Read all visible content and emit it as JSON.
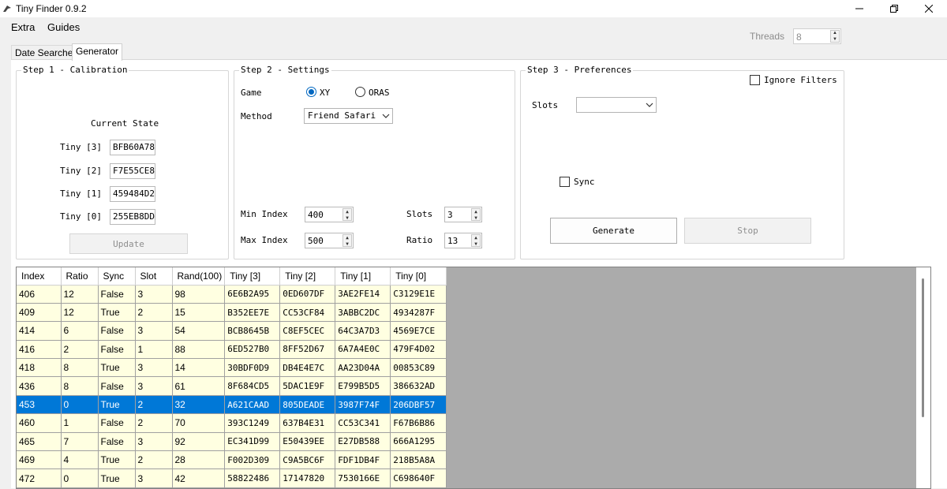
{
  "window": {
    "title": "Tiny Finder 0.9.2"
  },
  "menu": {
    "items": [
      {
        "label": "Extra"
      },
      {
        "label": "Guides"
      }
    ]
  },
  "threads": {
    "label": "Threads",
    "value": "8"
  },
  "tabs": [
    {
      "label": "Date Searcher"
    },
    {
      "label": "Generator"
    }
  ],
  "step1": {
    "title": "Step 1 - Calibration",
    "current_state_label": "Current State",
    "rows": [
      {
        "label": "Tiny [3]",
        "value": "BFB60A78"
      },
      {
        "label": "Tiny [2]",
        "value": "F7E55CE8"
      },
      {
        "label": "Tiny [1]",
        "value": "459484D2"
      },
      {
        "label": "Tiny [0]",
        "value": "255EB8DD"
      }
    ],
    "update_label": "Update"
  },
  "step2": {
    "title": "Step 2 - Settings",
    "game_label": "Game",
    "game_options": [
      {
        "label": "XY",
        "selected": true
      },
      {
        "label": "ORAS",
        "selected": false
      }
    ],
    "method_label": "Method",
    "method_value": "Friend Safari",
    "min_index_label": "Min Index",
    "min_index_value": "400",
    "max_index_label": "Max Index",
    "max_index_value": "500",
    "slots_label": "Slots",
    "slots_value": "3",
    "ratio_label": "Ratio",
    "ratio_value": "13"
  },
  "step3": {
    "title": "Step 3 - Preferences",
    "ignore_filters_label": "Ignore Filters",
    "slots_label": "Slots",
    "slots_value": "",
    "sync_label": "Sync",
    "generate_label": "Generate",
    "stop_label": "Stop"
  },
  "results": {
    "columns": [
      "Index",
      "Ratio",
      "Sync",
      "Slot",
      "Rand(100)",
      "Tiny [3]",
      "Tiny [2]",
      "Tiny [1]",
      "Tiny [0]"
    ],
    "selected_row": 6,
    "rows": [
      [
        "406",
        "12",
        "False",
        "3",
        "98",
        "6E6B2A95",
        "0ED607DF",
        "3AE2FE14",
        "C3129E1E"
      ],
      [
        "409",
        "12",
        "True",
        "2",
        "15",
        "B352EE7E",
        "CC53CF84",
        "3ABBC2DC",
        "4934287F"
      ],
      [
        "414",
        "6",
        "False",
        "3",
        "54",
        "BCB8645B",
        "C8EF5CEC",
        "64C3A7D3",
        "4569E7CE"
      ],
      [
        "416",
        "2",
        "False",
        "1",
        "88",
        "6ED527B0",
        "8FF52D67",
        "6A7A4E0C",
        "479F4D02"
      ],
      [
        "418",
        "8",
        "True",
        "3",
        "14",
        "30BDF0D9",
        "DB4E4E7C",
        "AA23D04A",
        "00853C89"
      ],
      [
        "436",
        "8",
        "False",
        "3",
        "61",
        "8F684CD5",
        "5DAC1E9F",
        "E799B5D5",
        "386632AD"
      ],
      [
        "453",
        "0",
        "True",
        "2",
        "32",
        "A621CAAD",
        "805DEADE",
        "3987F74F",
        "206DBF57"
      ],
      [
        "460",
        "1",
        "False",
        "2",
        "70",
        "393C1249",
        "637B4E31",
        "CC53C341",
        "F67B6B86"
      ],
      [
        "465",
        "7",
        "False",
        "3",
        "92",
        "EC341D99",
        "E50439EE",
        "E27DB588",
        "666A1295"
      ],
      [
        "469",
        "4",
        "True",
        "2",
        "28",
        "F002D309",
        "C9A5BC6F",
        "FDF1DB4F",
        "218B5A8A"
      ],
      [
        "472",
        "0",
        "True",
        "3",
        "42",
        "58822486",
        "17147820",
        "7530166E",
        "C698640F"
      ],
      [
        "",
        "",
        "",
        "",
        "",
        "",
        "",
        "",
        ""
      ]
    ]
  },
  "colors": {
    "accent": "#0078d7",
    "row_bg": "#ffffe1",
    "grid_bg": "#ababab"
  }
}
